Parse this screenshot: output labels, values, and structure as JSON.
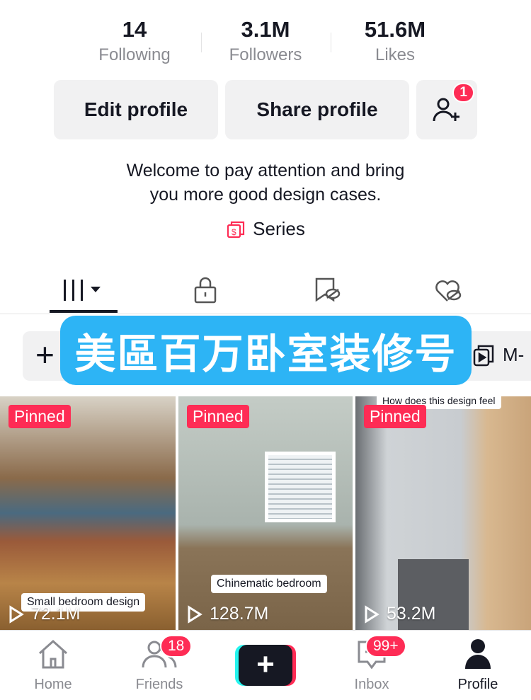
{
  "stats": [
    {
      "value": "14",
      "label": "Following"
    },
    {
      "value": "3.1M",
      "label": "Followers"
    },
    {
      "value": "51.6M",
      "label": "Likes"
    }
  ],
  "buttons": {
    "edit": "Edit profile",
    "share": "Share profile",
    "add_friend_badge": "1"
  },
  "bio": {
    "line1": "Welcome to pay attention and bring",
    "line2": "you more good design cases."
  },
  "series_label": "Series",
  "banner": "美區百万卧室装修号",
  "chips": {
    "add": "+",
    "playlist": "M-"
  },
  "videos": [
    {
      "pinned": "Pinned",
      "caption": "Small bedroom design",
      "views": "72.1M"
    },
    {
      "pinned": "Pinned",
      "caption": "Chinematic bedroom",
      "views": "128.7M"
    },
    {
      "pinned": "Pinned",
      "caption": "How does this design feel",
      "views": "53.2M"
    }
  ],
  "nav": {
    "home": "Home",
    "friends": "Friends",
    "friends_badge": "18",
    "create": "+",
    "inbox": "Inbox",
    "inbox_badge": "99+",
    "profile": "Profile"
  },
  "colors": {
    "accent": "#fe2c55",
    "banner": "#2db4f5"
  }
}
